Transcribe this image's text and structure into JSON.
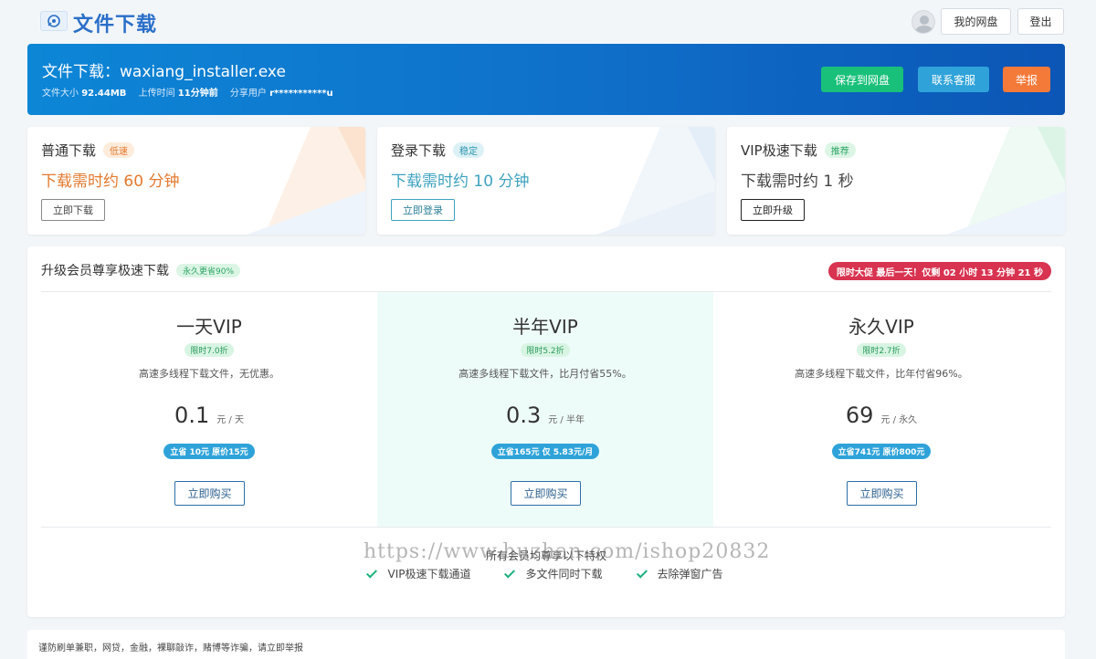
{
  "header": {
    "title": "文件下载",
    "my_disk": "我的网盘",
    "logout": "登出"
  },
  "file": {
    "title": "文件下载：waxiang_installer.exe",
    "size_label": "文件大小",
    "size": "92.44MB",
    "upload_label": "上传时间",
    "upload_time": "11分钟前",
    "sharer_label": "分享用户",
    "sharer": "r***********u",
    "save_btn": "保存到网盘",
    "service_btn": "联系客服",
    "report_btn": "举报"
  },
  "options": [
    {
      "title": "普通下载",
      "tag": "低速",
      "time": "下载需时约 60 分钟",
      "button": "立即下载",
      "color": "#e4792e"
    },
    {
      "title": "登录下载",
      "tag": "稳定",
      "time": "下载需时约 10 分钟",
      "button": "立即登录",
      "color": "#3ea2bf"
    },
    {
      "title": "VIP极速下载",
      "tag": "推荐",
      "time": "下载需时约 1 秒",
      "button": "立即升级",
      "color": "#444444"
    }
  ],
  "vip": {
    "heading": "升级会员尊享极速下载",
    "heading_tag": "永久更省90%",
    "countdown": "限时大促 最后一天！仅剩 02 小时 13 分钟 21 秒",
    "plans": [
      {
        "name": "一天VIP",
        "discount": "限时7.0折",
        "desc": "高速多线程下载文件，无优惠。",
        "price": "0.1",
        "unit": "元 / 天",
        "saving": "立省 10元 原价15元",
        "buy": "立即购买"
      },
      {
        "name": "半年VIP",
        "discount": "限时5.2折",
        "desc": "高速多线程下载文件，比月付省55%。",
        "price": "0.3",
        "unit": "元 / 半年",
        "saving": "立省165元 仅 5.83元/月",
        "buy": "立即购买"
      },
      {
        "name": "永久VIP",
        "discount": "限时2.7折",
        "desc": "高速多线程下载文件，比年付省96%。",
        "price": "69",
        "unit": "元 / 永久",
        "saving": "立省741元 原价800元",
        "buy": "立即购买"
      }
    ],
    "perks_title": "所有会员均尊享以下特权",
    "perks": [
      "VIP极速下载通道",
      "多文件同时下载",
      "去除弹窗广告"
    ]
  },
  "watermark": "https://www.huzhan.com/ishop20832",
  "notice": "谨防刷单兼职，网贷，金融，裸聊敲诈，赌博等诈骗，请立即举报"
}
